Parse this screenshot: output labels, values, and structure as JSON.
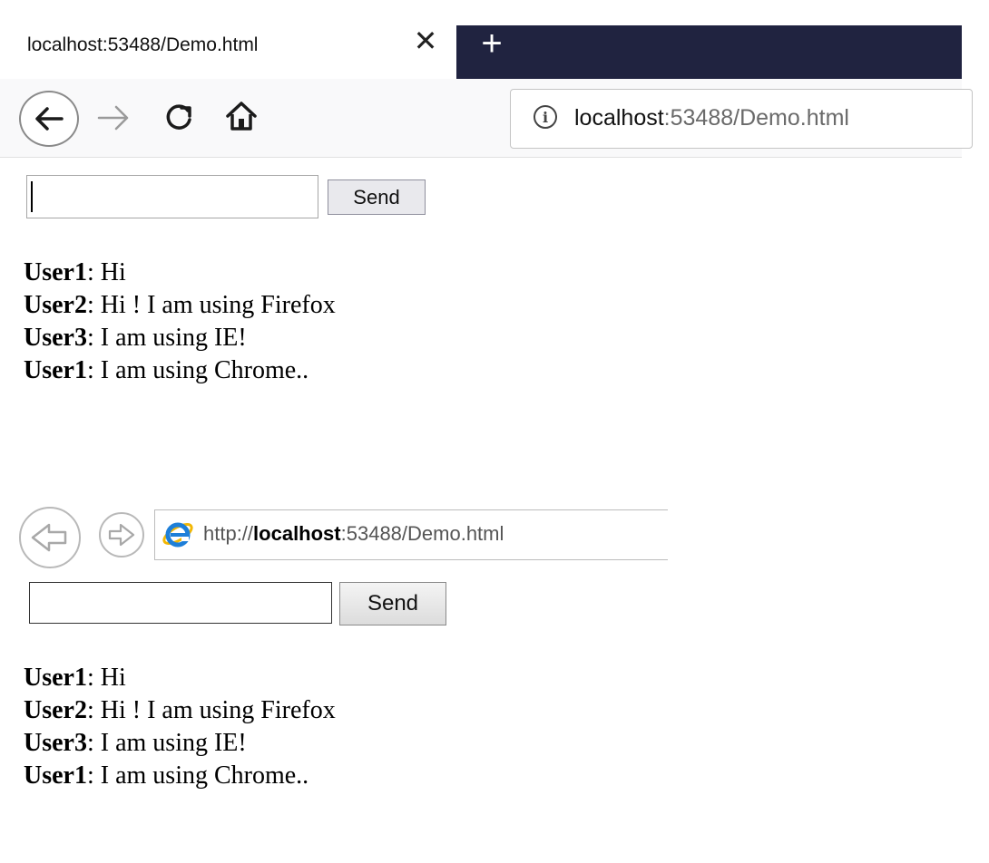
{
  "firefox": {
    "tab_title": "localhost:53488/Demo.html",
    "tab_close_glyph": "✕",
    "new_tab_glyph": "+",
    "url_host": "localhost",
    "url_rest": ":53488/Demo.html",
    "icons": [
      "back-arrow-icon",
      "forward-arrow-icon",
      "reload-icon",
      "home-icon",
      "info-icon"
    ],
    "colors": {
      "tabstrip_dark": "#202340",
      "toolbar": "#f9f9fa"
    },
    "send_label": "Send",
    "input_value": "",
    "messages": [
      {
        "user": "User1",
        "text": ":  Hi"
      },
      {
        "user": "User2",
        "text": ":  Hi ! I am using Firefox"
      },
      {
        "user": "User3",
        "text": ":  I am using IE!"
      },
      {
        "user": "User1",
        "text": ":  I am using Chrome.."
      }
    ]
  },
  "ie": {
    "url_scheme": "http://",
    "url_host": "localhost",
    "url_rest": ":53488/Demo.html",
    "icons": [
      "back-arrow-icon",
      "forward-arrow-icon",
      "ie-logo-icon"
    ],
    "send_label": "Send",
    "input_value": "",
    "messages": [
      {
        "user": "User1",
        "text": ":  Hi"
      },
      {
        "user": "User2",
        "text": ":  Hi ! I am using Firefox"
      },
      {
        "user": "User3",
        "text": ":  I am using IE!"
      },
      {
        "user": "User1",
        "text": ":  I am using Chrome.."
      }
    ]
  }
}
